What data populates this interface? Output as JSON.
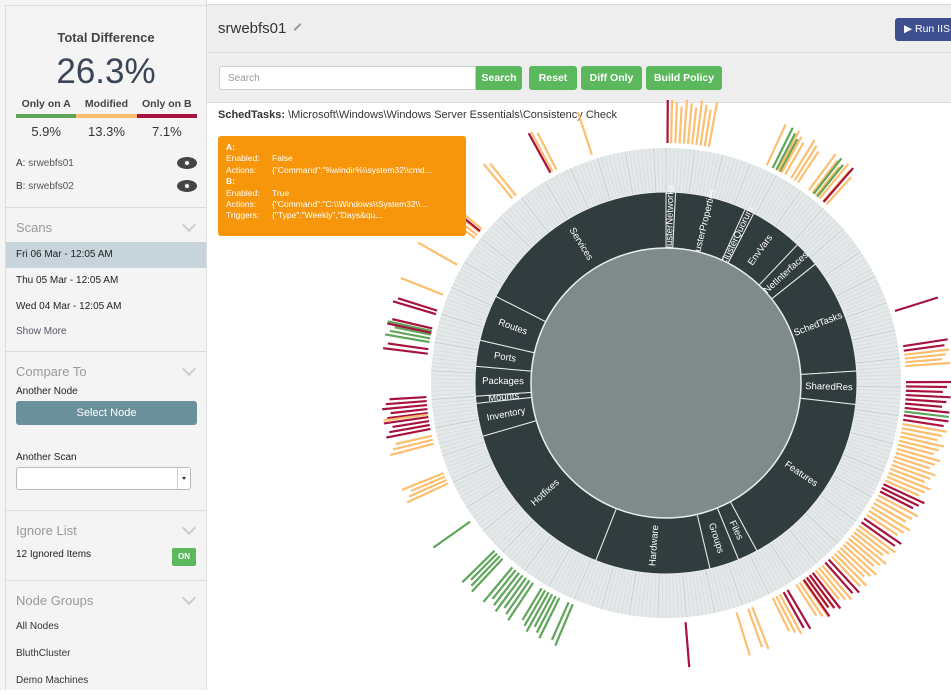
{
  "summary": {
    "title": "Total Difference",
    "value": "26.3%",
    "breakdown": [
      {
        "label": "Only on A",
        "value": "5.9%",
        "color": "#5fa55a"
      },
      {
        "label": "Modified",
        "value": "13.3%",
        "color": "#fdbf6f"
      },
      {
        "label": "Only on B",
        "value": "7.1%",
        "color": "#a8123e"
      }
    ],
    "node_a_prefix": "A:",
    "node_a": "srwebfs01",
    "node_b_prefix": "B:",
    "node_b": "srwebfs02"
  },
  "scans": {
    "title": "Scans",
    "items": [
      "Fri 06 Mar - 12:05 AM",
      "Thu 05 Mar - 12:05 AM",
      "Wed 04 Mar - 12:05 AM"
    ],
    "selected_index": 0,
    "show_more": "Show More"
  },
  "compare": {
    "title": "Compare To",
    "another_node_label": "Another Node",
    "select_node_button": "Select Node",
    "another_scan_label": "Another Scan",
    "another_scan_value": ""
  },
  "ignore": {
    "title": "Ignore List",
    "count_label": "12 Ignored Items",
    "toggle": "ON"
  },
  "node_groups": {
    "title": "Node Groups",
    "items": [
      "All Nodes",
      "BluthCluster",
      "Demo Machines"
    ]
  },
  "header": {
    "title": "srwebfs01",
    "run_button": "▶ Run IIS"
  },
  "toolbar": {
    "search_placeholder": "Search",
    "search_button": "Search",
    "reset_button": "Reset",
    "diff_only_button": "Diff Only",
    "build_policy_button": "Build Policy"
  },
  "selection_path": {
    "category": "SchedTasks:",
    "path": " \\Microsoft\\Windows\\Windows Server Essentials\\Consistency Check"
  },
  "tooltip": {
    "a_header": "A:",
    "a_rows": [
      {
        "key": "Enabled:",
        "value": "False"
      },
      {
        "key": "Actions:",
        "value": "{\"Command\":\"%windir%\\\\system32\\\\cmd..."
      }
    ],
    "b_header": "B:",
    "b_rows": [
      {
        "key": "Enabled:",
        "value": "True"
      },
      {
        "key": "Actions:",
        "value": "{\"Command\":\"C:\\\\Windows\\\\System32\\\\..."
      },
      {
        "key": "Triggers:",
        "value": "{\"Type\":\"Weekly\",\"Days&qu..."
      }
    ]
  },
  "chart_data": {
    "type": "sunburst",
    "title": "",
    "legend": [
      {
        "label": "Only on A",
        "color": "#5fa55a"
      },
      {
        "label": "Modified",
        "color": "#fdbf6f"
      },
      {
        "label": "Only on B",
        "color": "#a8123e"
      }
    ],
    "categories": [
      {
        "name": "ClusterNetworks",
        "share": 0.008
      },
      {
        "name": "ClusterProperties",
        "share": 0.06
      },
      {
        "name": "ClusterQuorum",
        "share": 0.008
      },
      {
        "name": "EnvVars",
        "share": 0.045
      },
      {
        "name": "NetInterfaces",
        "share": 0.022
      },
      {
        "name": "SchedTasks",
        "share": 0.097
      },
      {
        "name": "SharedRes",
        "share": 0.028
      },
      {
        "name": "Features",
        "share": 0.153
      },
      {
        "name": "Files",
        "share": 0.017
      },
      {
        "name": "Groups",
        "share": 0.025
      },
      {
        "name": "Hardware",
        "share": 0.097
      },
      {
        "name": "Hotfixes",
        "share": 0.145
      },
      {
        "name": "Inventory",
        "share": 0.028
      },
      {
        "name": "Mounts",
        "share": 0.006
      },
      {
        "name": "Packages",
        "share": 0.025
      },
      {
        "name": "Ports",
        "share": 0.022
      },
      {
        "name": "Routes",
        "share": 0.039
      },
      {
        "name": "Services",
        "share": 0.175
      }
    ],
    "diff_bands": [
      {
        "from": 0.0,
        "to": 0.002,
        "type": "B"
      },
      {
        "from": 0.002,
        "to": 0.03,
        "type": "M"
      },
      {
        "from": 0.068,
        "to": 0.07,
        "type": "M"
      },
      {
        "from": 0.072,
        "to": 0.08,
        "type": "A"
      },
      {
        "from": 0.076,
        "to": 0.084,
        "type": "M"
      },
      {
        "from": 0.086,
        "to": 0.094,
        "type": "M"
      },
      {
        "from": 0.1,
        "to": 0.118,
        "type": "M"
      },
      {
        "from": 0.104,
        "to": 0.11,
        "type": "A"
      },
      {
        "from": 0.112,
        "to": 0.116,
        "type": "B"
      },
      {
        "from": 0.2,
        "to": 0.203,
        "type": "B"
      },
      {
        "from": 0.224,
        "to": 0.23,
        "type": "B"
      },
      {
        "from": 0.23,
        "to": 0.24,
        "type": "M"
      },
      {
        "from": 0.248,
        "to": 0.268,
        "type": "B"
      },
      {
        "from": 0.268,
        "to": 0.27,
        "type": "A"
      },
      {
        "from": 0.27,
        "to": 0.276,
        "type": "B"
      },
      {
        "from": 0.276,
        "to": 0.318,
        "type": "M"
      },
      {
        "from": 0.318,
        "to": 0.326,
        "type": "B"
      },
      {
        "from": 0.326,
        "to": 0.344,
        "type": "M"
      },
      {
        "from": 0.344,
        "to": 0.35,
        "type": "B"
      },
      {
        "from": 0.35,
        "to": 0.38,
        "type": "M"
      },
      {
        "from": 0.38,
        "to": 0.386,
        "type": "B"
      },
      {
        "from": 0.386,
        "to": 0.41,
        "type": "M"
      },
      {
        "from": 0.394,
        "to": 0.404,
        "type": "B"
      },
      {
        "from": 0.414,
        "to": 0.42,
        "type": "B"
      },
      {
        "from": 0.42,
        "to": 0.428,
        "type": "M"
      },
      {
        "from": 0.44,
        "to": 0.446,
        "type": "M"
      },
      {
        "from": 0.451,
        "to": 0.454,
        "type": "M"
      },
      {
        "from": 0.486,
        "to": 0.488,
        "type": "B"
      },
      {
        "from": 0.562,
        "to": 0.568,
        "type": "A"
      },
      {
        "from": 0.572,
        "to": 0.588,
        "type": "A"
      },
      {
        "from": 0.592,
        "to": 0.612,
        "type": "A"
      },
      {
        "from": 0.618,
        "to": 0.628,
        "type": "A"
      },
      {
        "from": 0.65,
        "to": 0.654,
        "type": "A"
      },
      {
        "from": 0.68,
        "to": 0.69,
        "type": "M"
      },
      {
        "from": 0.708,
        "to": 0.716,
        "type": "M"
      },
      {
        "from": 0.718,
        "to": 0.742,
        "type": "B"
      },
      {
        "from": 0.728,
        "to": 0.73,
        "type": "M"
      },
      {
        "from": 0.768,
        "to": 0.774,
        "type": "B"
      },
      {
        "from": 0.776,
        "to": 0.786,
        "type": "A"
      },
      {
        "from": 0.782,
        "to": 0.788,
        "type": "B"
      },
      {
        "from": 0.795,
        "to": 0.8,
        "type": "B"
      },
      {
        "from": 0.808,
        "to": 0.812,
        "type": "M"
      },
      {
        "from": 0.83,
        "to": 0.834,
        "type": "M"
      },
      {
        "from": 0.852,
        "to": 0.862,
        "type": "M"
      },
      {
        "from": 0.858,
        "to": 0.86,
        "type": "B"
      },
      {
        "from": 0.888,
        "to": 0.894,
        "type": "M"
      },
      {
        "from": 0.918,
        "to": 0.922,
        "type": "B"
      },
      {
        "from": 0.92,
        "to": 0.926,
        "type": "M"
      },
      {
        "from": 0.948,
        "to": 0.952,
        "type": "M"
      }
    ]
  }
}
